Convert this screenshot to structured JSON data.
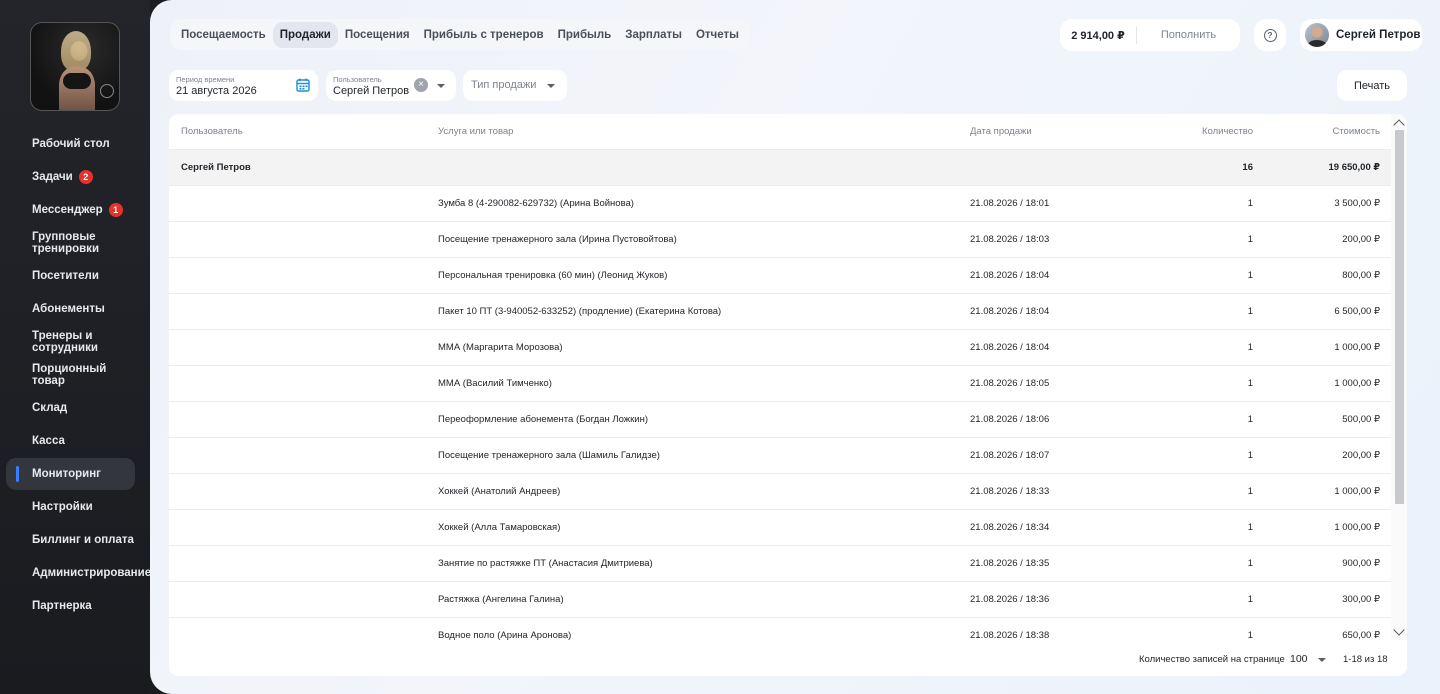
{
  "sidebar": {
    "items": [
      {
        "label": "Рабочий стол"
      },
      {
        "label": "Задачи",
        "badge": "2"
      },
      {
        "label": "Мессенджер",
        "badge": "1"
      },
      {
        "label": "Групповые тренировки"
      },
      {
        "label": "Посетители"
      },
      {
        "label": "Абонементы"
      },
      {
        "label": "Тренеры и сотрудники"
      },
      {
        "label": "Порционный товар"
      },
      {
        "label": "Склад"
      },
      {
        "label": "Касса"
      },
      {
        "label": "Мониторинг",
        "active": true
      },
      {
        "label": "Настройки"
      },
      {
        "label": "Биллинг и оплата"
      },
      {
        "label": "Администрирование"
      },
      {
        "label": "Партнерка"
      }
    ]
  },
  "tabs": [
    {
      "label": "Посещаемость"
    },
    {
      "label": "Продажи",
      "active": true
    },
    {
      "label": "Посещения"
    },
    {
      "label": "Прибыль с тренеров"
    },
    {
      "label": "Прибыль"
    },
    {
      "label": "Зарплаты"
    },
    {
      "label": "Отчеты"
    }
  ],
  "header": {
    "balance": "2 914,00 ₽",
    "topup_label": "Пополнить",
    "help_glyph": "?",
    "user_name": "Сергей Петров"
  },
  "filters": {
    "period_label": "Период времени",
    "period_value": "21 августа 2026",
    "user_label": "Пользователь",
    "user_value": "Сергей Петров",
    "type_placeholder": "Тип продажи",
    "print_label": "Печать"
  },
  "table": {
    "columns": {
      "user": "Пользователь",
      "item": "Услуга или товар",
      "date": "Дата продажи",
      "qty": "Количество",
      "cost": "Стоимость"
    },
    "group": {
      "user": "Сергей Петров",
      "qty": "16",
      "cost": "19 650,00 ₽"
    },
    "rows": [
      {
        "item": "Зумба 8 (4-290082-629732) (Арина Войнова)",
        "date": "21.08.2026 / 18:01",
        "qty": "1",
        "cost": "3 500,00 ₽"
      },
      {
        "item": "Посещение тренажерного зала (Ирина Пустовойтова)",
        "date": "21.08.2026 / 18:03",
        "qty": "1",
        "cost": "200,00 ₽"
      },
      {
        "item": "Персональная тренировка (60 мин) (Леонид Жуков)",
        "date": "21.08.2026 / 18:04",
        "qty": "1",
        "cost": "800,00 ₽"
      },
      {
        "item": "Пакет 10 ПТ (3-940052-633252) (продление) (Екатерина Котова)",
        "date": "21.08.2026 / 18:04",
        "qty": "1",
        "cost": "6 500,00 ₽"
      },
      {
        "item": "ММА (Маргарита Морозова)",
        "date": "21.08.2026 / 18:04",
        "qty": "1",
        "cost": "1 000,00 ₽"
      },
      {
        "item": "ММА (Василий Тимченко)",
        "date": "21.08.2026 / 18:05",
        "qty": "1",
        "cost": "1 000,00 ₽"
      },
      {
        "item": "Переоформление абонемента (Богдан Ложкин)",
        "date": "21.08.2026 / 18:06",
        "qty": "1",
        "cost": "500,00 ₽"
      },
      {
        "item": "Посещение тренажерного зала (Шамиль Галидзе)",
        "date": "21.08.2026 / 18:07",
        "qty": "1",
        "cost": "200,00 ₽"
      },
      {
        "item": "Хоккей (Анатолий Андреев)",
        "date": "21.08.2026 / 18:33",
        "qty": "1",
        "cost": "1 000,00 ₽"
      },
      {
        "item": "Хоккей (Алла Тамаровская)",
        "date": "21.08.2026 / 18:34",
        "qty": "1",
        "cost": "1 000,00 ₽"
      },
      {
        "item": "Занятие по растяжке ПТ (Анастасия Дмитриева)",
        "date": "21.08.2026 / 18:35",
        "qty": "1",
        "cost": "900,00 ₽"
      },
      {
        "item": "Растяжка (Ангелина Галина)",
        "date": "21.08.2026 / 18:36",
        "qty": "1",
        "cost": "300,00 ₽"
      },
      {
        "item": "Водное поло (Арина Аронова)",
        "date": "21.08.2026 / 18:38",
        "qty": "1",
        "cost": "650,00 ₽"
      }
    ]
  },
  "pagination": {
    "per_page_label": "Количество записей на странице",
    "per_page_value": "100",
    "range": "1-18 из 18"
  }
}
